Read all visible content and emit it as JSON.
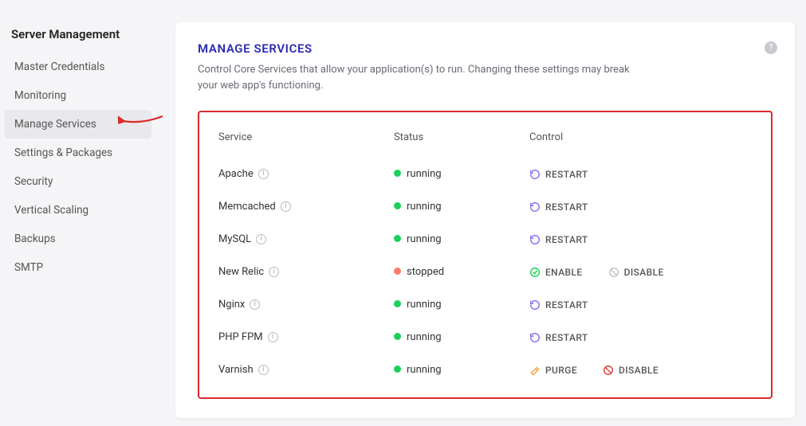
{
  "sidebar": {
    "heading": "Server Management",
    "items": [
      {
        "label": "Master Credentials",
        "active": false
      },
      {
        "label": "Monitoring",
        "active": false
      },
      {
        "label": "Manage Services",
        "active": true
      },
      {
        "label": "Settings & Packages",
        "active": false
      },
      {
        "label": "Security",
        "active": false
      },
      {
        "label": "Vertical Scaling",
        "active": false
      },
      {
        "label": "Backups",
        "active": false
      },
      {
        "label": "SMTP",
        "active": false
      }
    ]
  },
  "header": {
    "title": "MANAGE SERVICES",
    "description": "Control Core Services that allow your application(s) to run. Changing these settings may break your web app's functioning."
  },
  "table": {
    "columns": {
      "service": "Service",
      "status": "Status",
      "control": "Control"
    }
  },
  "services": [
    {
      "name": "Apache",
      "info": true,
      "status": "running",
      "controls": [
        {
          "type": "restart",
          "label": "RESTART"
        }
      ]
    },
    {
      "name": "Memcached",
      "info": true,
      "status": "running",
      "controls": [
        {
          "type": "restart",
          "label": "RESTART"
        }
      ]
    },
    {
      "name": "MySQL",
      "info": true,
      "status": "running",
      "controls": [
        {
          "type": "restart",
          "label": "RESTART"
        }
      ]
    },
    {
      "name": "New Relic",
      "info": true,
      "status": "stopped",
      "controls": [
        {
          "type": "enable",
          "label": "ENABLE"
        },
        {
          "type": "disable",
          "label": "DISABLE",
          "disabled": true
        }
      ]
    },
    {
      "name": "Nginx",
      "info": true,
      "status": "running",
      "controls": [
        {
          "type": "restart",
          "label": "RESTART"
        }
      ]
    },
    {
      "name": "PHP FPM",
      "info": true,
      "status": "running",
      "controls": [
        {
          "type": "restart",
          "label": "RESTART"
        }
      ]
    },
    {
      "name": "Varnish",
      "info": true,
      "status": "running",
      "controls": [
        {
          "type": "purge",
          "label": "PURGE"
        },
        {
          "type": "disable",
          "label": "DISABLE"
        }
      ]
    }
  ],
  "status_labels": {
    "running": "running",
    "stopped": "stopped"
  }
}
